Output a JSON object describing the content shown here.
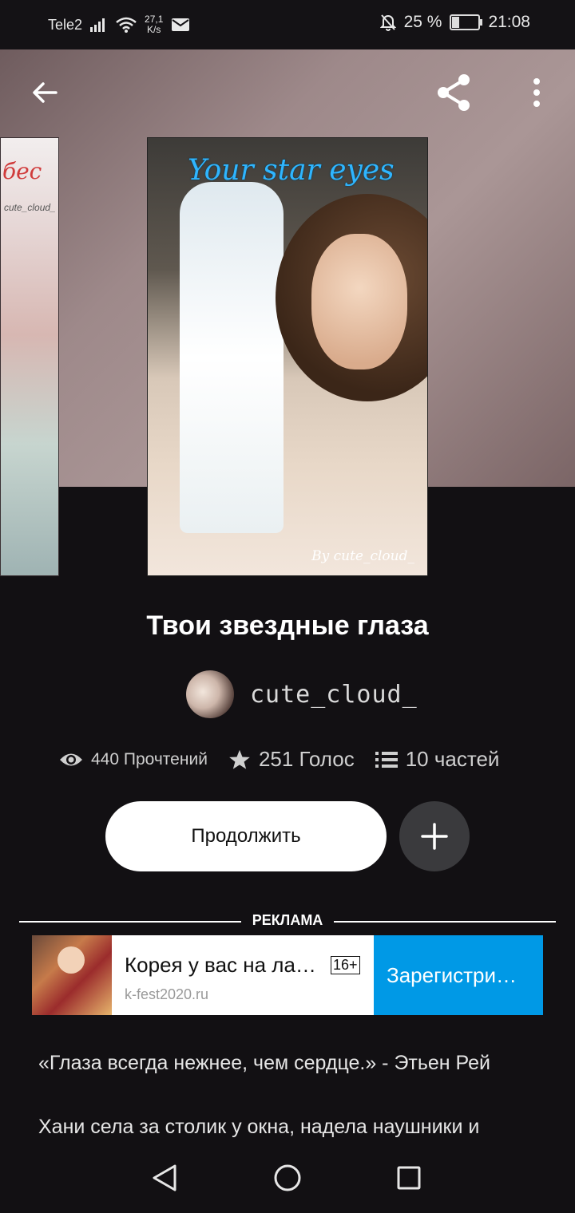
{
  "status": {
    "carrier": "Tele2",
    "speed": "27,1",
    "speed_unit": "K/s",
    "battery": "25 %",
    "time": "21:08"
  },
  "top_bar": {
    "back_icon": "arrow-left-icon",
    "share_icon": "share-icon",
    "more_icon": "more-vertical-icon"
  },
  "covers": {
    "side_text": "бес",
    "side_author": "cute_cloud_",
    "main_text": "Your star eyes",
    "main_author": "By cute_cloud_"
  },
  "story": {
    "title": "Твои звездные глаза",
    "author": "cute_cloud_",
    "reads": "440 Прочтений",
    "votes": "251 Голос",
    "parts": "10 частей",
    "continue_label": "Продолжить"
  },
  "ad": {
    "label": "РЕКЛАМА",
    "headline": "Корея у вас на ла…",
    "age": "16+",
    "url": "k-fest2020.ru",
    "cta": "Зарегистри…"
  },
  "text": {
    "p1": "«Глаза всегда нежнее, чем сердце.» - Этьен Рей",
    "p2": "Хани села за столик у окна, надела наушники и"
  },
  "colors": {
    "background": "#121013",
    "ad_cta": "#0099e6",
    "cover_title": "#2fb5ff"
  }
}
